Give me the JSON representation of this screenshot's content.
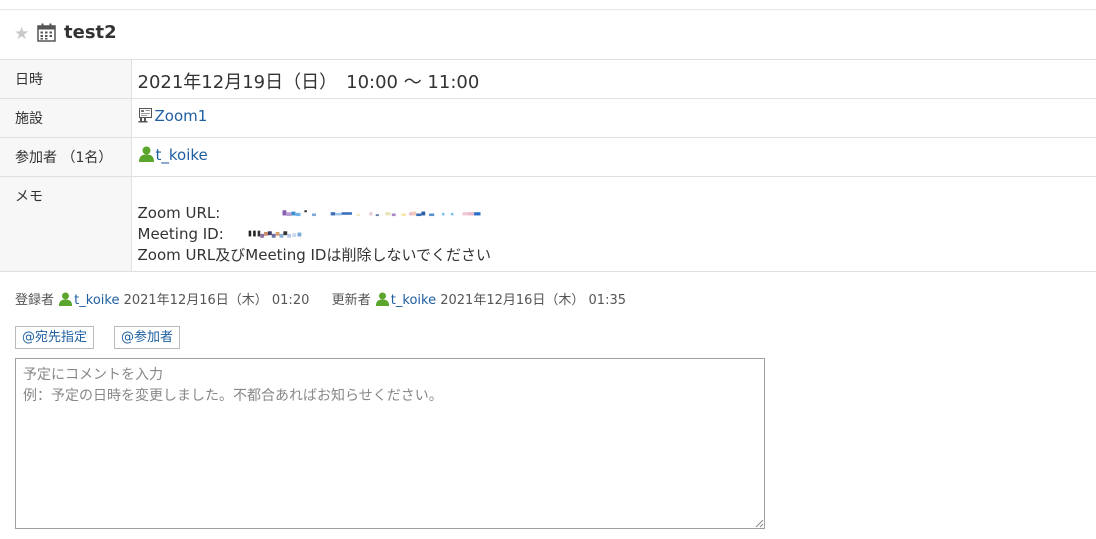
{
  "title": "test2",
  "rows": {
    "datetime": {
      "label": "日時",
      "value": "2021年12月19日（日）　10:00 〜 11:00"
    },
    "facility": {
      "label": "施設",
      "value": "Zoom1"
    },
    "participants": {
      "label": "参加者 （1名）",
      "value": "t_koike"
    },
    "memo": {
      "label": "メモ",
      "zoom_url_label": "Zoom URL:",
      "meeting_id_label": "Meeting ID:",
      "note": " Zoom URL及びMeeting IDは削除しないでください"
    }
  },
  "meta": {
    "registered_label": "登録者",
    "registered_user": "t_koike",
    "registered_at": "2021年12月16日（木） 01:20",
    "updated_label": "更新者",
    "updated_user": "t_koike",
    "updated_at": "2021年12月16日（木） 01:35"
  },
  "mentions": {
    "recipient": "@宛先指定",
    "participants": "@参加者"
  },
  "comment": {
    "placeholder": "予定にコメントを入力\n例：予定の日時を変更しました。不都合あればお知らせください。"
  },
  "colors": {
    "link": "#1f5fa0",
    "user_icon": "#5aa52c",
    "label_bg": "#f7f7f7"
  }
}
